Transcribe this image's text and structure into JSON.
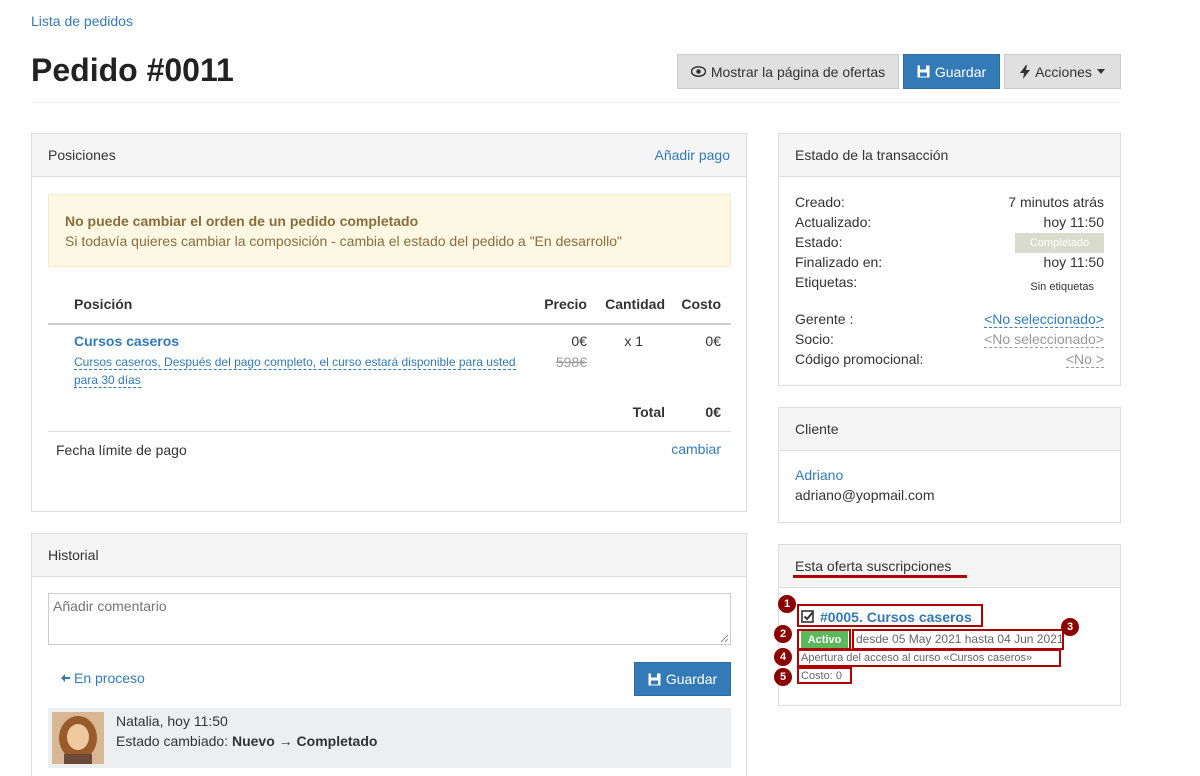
{
  "breadcrumb": "Lista de pedidos",
  "title": "Pedido #0011",
  "toolbar": {
    "show_offers": "Mostrar la página de ofertas",
    "save": "Guardar",
    "actions": "Acciones"
  },
  "positions": {
    "heading": "Posiciones",
    "add_payment": "Añadir pago",
    "alert_title": "No puede cambiar el orden de un pedido completado",
    "alert_text": "Si todavía quieres cambiar la composición - cambia el estado del pedido a \"En desarrollo\"",
    "columns": {
      "position": "Posición",
      "price": "Precio",
      "quantity": "Cantidad",
      "cost": "Costo"
    },
    "item": {
      "name": "Cursos caseros",
      "desc_line1": "Cursos caseros, Después del pago completo, el curso estará disponible para usted",
      "desc_line2": "para 30 días",
      "price": "0€",
      "old_price": "598€",
      "quantity": "x 1",
      "cost": "0€"
    },
    "total_label": "Total",
    "total_value": "0€",
    "deadline_label": "Fecha límite de pago",
    "deadline_action": "cambiar"
  },
  "history": {
    "heading": "Historial",
    "comment_placeholder": "Añadir comentario",
    "status_link": "En proceso",
    "save": "Guardar",
    "entry_author": "Natalia",
    "entry_time": "hoy 11:50",
    "entry_prefix": "Estado cambiado:",
    "entry_from": "Nuevo",
    "entry_to": "Completado"
  },
  "transaction": {
    "heading": "Estado de la transacción",
    "created_label": "Creado:",
    "created_value": "7 minutos atrás",
    "updated_label": "Actualizado:",
    "updated_value": "hoy 11:50",
    "status_label": "Estado:",
    "status_value": "Completado",
    "finished_label": "Finalizado en:",
    "finished_value": "hoy 11:50",
    "tags_label": "Etiquetas:",
    "tags_value": "Sin etiquetas",
    "manager_label": "Gerente :",
    "manager_value": "<No seleccionado>",
    "partner_label": "Socio:",
    "partner_value": "<No seleccionado>",
    "promo_label": "Código promocional:",
    "promo_value": "<No >"
  },
  "client": {
    "heading": "Cliente",
    "name": "Adriano",
    "email": "adriano@yopmail.com"
  },
  "subscriptions": {
    "heading": "Esta oferta suscripciones",
    "item_title": "#0005. Cursos caseros",
    "status": "Activo",
    "period": "desde 05 May 2021 hasta 04 Jun 2021",
    "description": "Apertura del acceso al curso «Cursos caseros»",
    "cost": "Costo: 0",
    "markers": [
      "1",
      "2",
      "3",
      "4",
      "5"
    ]
  },
  "colors": {
    "accent": "#337ab7",
    "success": "#5cb85c",
    "annotation": "#b00000"
  }
}
